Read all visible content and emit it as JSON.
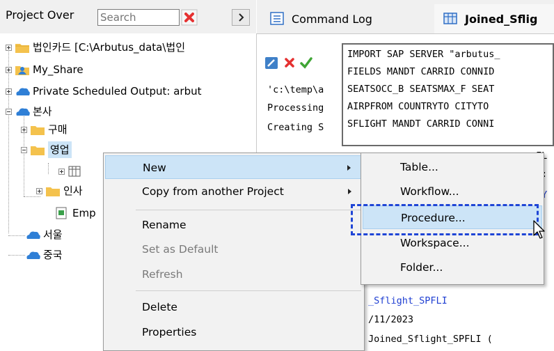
{
  "project_pane": {
    "title": "Project Over",
    "search_placeholder": "Search",
    "tree": [
      {
        "label": "법인카드 [C:\\Arbutus_data\\법인"
      },
      {
        "label": "My_Share"
      },
      {
        "label": "Private Scheduled Output: arbut"
      },
      {
        "label": "본사"
      },
      {
        "label": "구매"
      },
      {
        "label": "영업"
      },
      {
        "label": "인사"
      },
      {
        "label": "Emp"
      },
      {
        "label": "서울"
      },
      {
        "label": "중국"
      }
    ]
  },
  "tabs": [
    {
      "label": "Command Log"
    },
    {
      "label": "Joined_Sflig"
    }
  ],
  "log": {
    "lines": [
      "'c:\\temp\\a",
      "Processing",
      "Creating S"
    ],
    "popup_lines": [
      "IMPORT SAP SERVER \"arbutus_",
      "FIELDS MANDT CARRID CONNID",
      "SEATSOCC_B SEATSMAX_F SEAT",
      "AIRPFROM COUNTRYTO CITYTO",
      "SFLIGHT MANDT CARRID CONNI"
    ],
    "right_fragments": [
      "FL",
      "i:",
      "SY"
    ],
    "bottom_lines": [
      "_Sflight_SPFLI",
      "/11/2023",
      " Joined_Sflight_SPFLI ("
    ]
  },
  "context_menu": {
    "items": [
      {
        "label": "New",
        "has_submenu": true,
        "highlighted": true,
        "enabled": true
      },
      {
        "label": "Copy from another Project",
        "has_submenu": true,
        "highlighted": false,
        "enabled": true
      },
      {
        "label": "Rename",
        "has_submenu": false,
        "highlighted": false,
        "enabled": true
      },
      {
        "label": "Set as Default",
        "has_submenu": false,
        "highlighted": false,
        "enabled": false
      },
      {
        "label": "Refresh",
        "has_submenu": false,
        "highlighted": false,
        "enabled": false
      },
      {
        "label": "Delete",
        "has_submenu": false,
        "highlighted": false,
        "enabled": true
      },
      {
        "label": "Properties",
        "has_submenu": false,
        "highlighted": false,
        "enabled": true
      }
    ]
  },
  "submenu": {
    "items": [
      {
        "label": "Table...",
        "highlighted": false
      },
      {
        "label": "Workflow...",
        "highlighted": false
      },
      {
        "label": "Procedure...",
        "highlighted": true
      },
      {
        "label": "Workspace...",
        "highlighted": false
      },
      {
        "label": "Folder...",
        "highlighted": false
      }
    ]
  },
  "colors": {
    "folder_yellow": "#f4c24d",
    "share_blue": "#2f7fd6",
    "highlight_bg": "#cce4f7",
    "annotation_dash": "#1f45d6",
    "red_x": "#e53030",
    "check_green": "#3fa535"
  },
  "icons": {
    "clear": "red-x-icon",
    "pane_menu": "chevron-right-icon",
    "command_log_tab": "list-icon",
    "joined_tab": "table-icon",
    "toolbar": [
      "edit-icon",
      "delete-icon",
      "accept-icon"
    ],
    "cursor": "mouse-pointer-icon"
  }
}
